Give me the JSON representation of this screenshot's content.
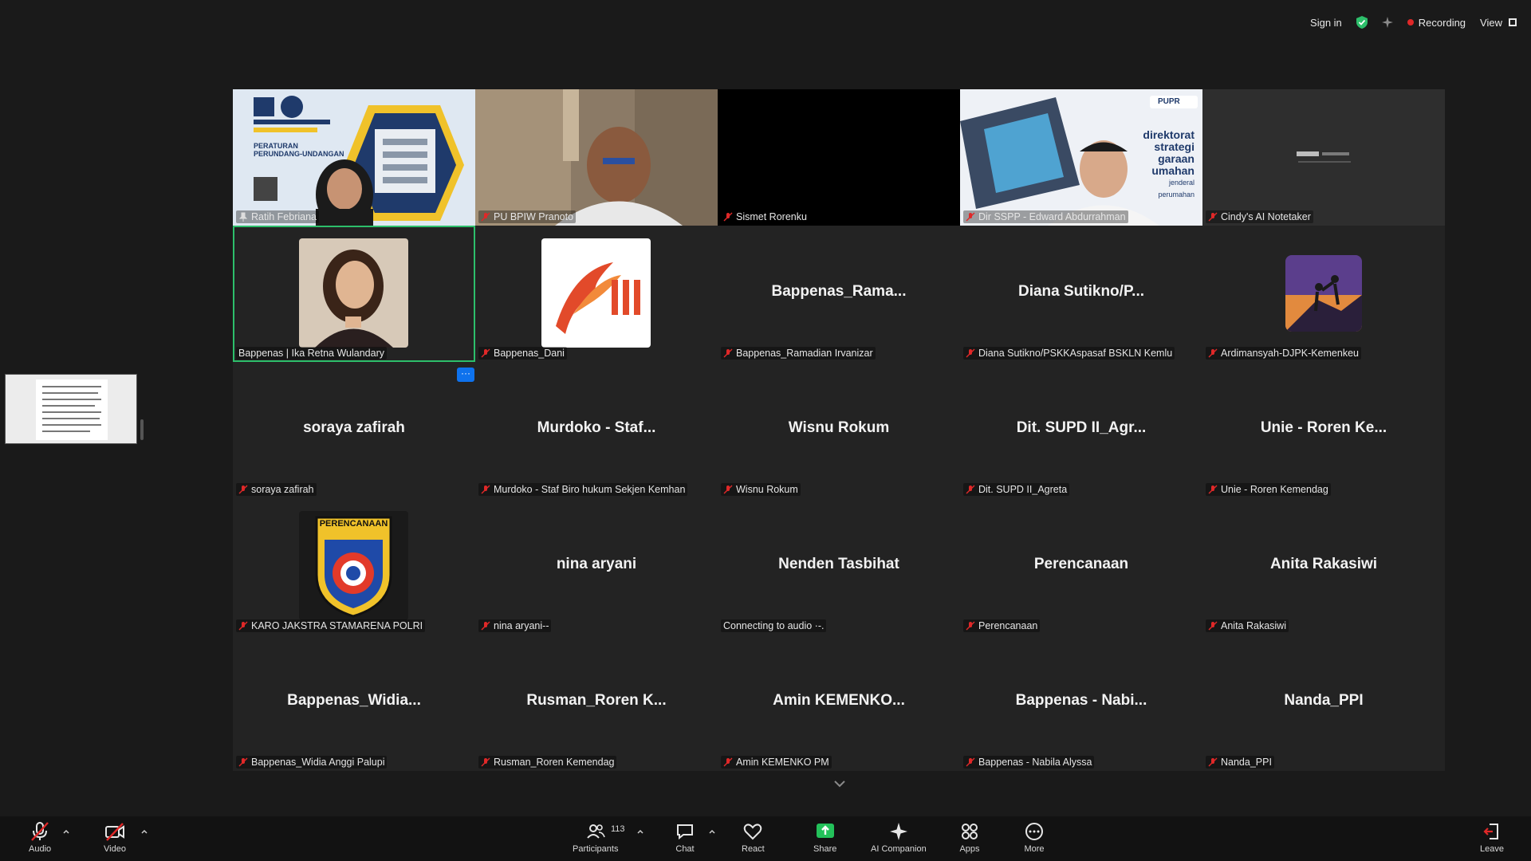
{
  "top": {
    "sign_in": "Sign in",
    "recording": "Recording",
    "view": "View"
  },
  "tiles": [
    {
      "name": "Ratih Febriana",
      "video": true,
      "big": ""
    },
    {
      "name": "PU BPIW Pranoto",
      "video": true,
      "big": ""
    },
    {
      "name": "Sismet Rorenku",
      "video": true,
      "big": ""
    },
    {
      "name": "Dir SSPP - Edward Abdurrahman",
      "video": true,
      "big": ""
    },
    {
      "name": "Cindy's AI Notetaker",
      "video": true,
      "big": ""
    },
    {
      "name": "Bappenas | Ika Retna Wulandary",
      "video": false,
      "big": ""
    },
    {
      "name": "Bappenas_Dani",
      "video": false,
      "big": ""
    },
    {
      "name": "Bappenas_Ramadian Irvanizar",
      "video": false,
      "big": "Bappenas_Rama..."
    },
    {
      "name": "Diana Sutikno/PSKKAspasaf BSKLN Kemlu",
      "video": false,
      "big": "Diana  Sutikno/P..."
    },
    {
      "name": "Ardimansyah-DJPK-Kemenkeu",
      "video": false,
      "big": ""
    },
    {
      "name": "soraya zafirah",
      "video": false,
      "big": "soraya zafirah"
    },
    {
      "name": "Murdoko - Staf Biro hukum Sekjen Kemhan",
      "video": false,
      "big": "Murdoko  - Staf..."
    },
    {
      "name": "Wisnu Rokum",
      "video": false,
      "big": "Wisnu Rokum"
    },
    {
      "name": "Dit. SUPD II_Agreta",
      "video": false,
      "big": "Dit. SUPD II_Agr..."
    },
    {
      "name": "Unie - Roren Kemendag",
      "video": false,
      "big": "Unie  - Roren Ke..."
    },
    {
      "name": "KARO JAKSTRA STAMARENA POLRI",
      "video": false,
      "big": ""
    },
    {
      "name": "nina aryani--",
      "video": false,
      "big": "nina aryani"
    },
    {
      "name": "Connecting to audio ·-.",
      "video": false,
      "big": "Nenden Tasbihat"
    },
    {
      "name": "Perencanaan",
      "video": false,
      "big": "Perencanaan"
    },
    {
      "name": "Anita Rakasiwi",
      "video": false,
      "big": "Anita Rakasiwi"
    },
    {
      "name": "Bappenas_Widia Anggi Palupi",
      "video": false,
      "big": "Bappenas_Widia..."
    },
    {
      "name": "Rusman_Roren Kemendag",
      "video": false,
      "big": "Rusman_Roren  K..."
    },
    {
      "name": "Amin KEMENKO PM",
      "video": false,
      "big": "Amin  KEMENKO..."
    },
    {
      "name": "Bappenas - Nabila Alyssa",
      "video": false,
      "big": "Bappenas  - Nabi..."
    },
    {
      "name": "Nanda_PPI",
      "video": false,
      "big": "Nanda_PPI"
    }
  ],
  "slide": {
    "pdp_line1": "PERATURAN",
    "pdp_line2": "PERUNDANG-UNDANGAN",
    "pupr_badge": "PUPR",
    "pupr_line1": "direktorat",
    "pupr_line2": "strategi",
    "pupr_line3": "garaan",
    "pupr_line4": "umahan",
    "pupr_line5": "jenderal",
    "pupr_line6": "perumahan",
    "perencanaan_logo": "PERENCANAAN"
  },
  "toolbar": {
    "audio": "Audio",
    "video": "Video",
    "participants": "Participants",
    "participants_count": "113",
    "chat": "Chat",
    "react": "React",
    "share": "Share",
    "ai_companion": "AI Companion",
    "apps": "Apps",
    "more": "More",
    "leave": "Leave"
  },
  "colors": {
    "active_border": "#2dbf6b",
    "share_green": "#23c15a",
    "recording_red": "#e02828",
    "leave_red": "#e02828",
    "accent_blue": "#0e72ed"
  }
}
